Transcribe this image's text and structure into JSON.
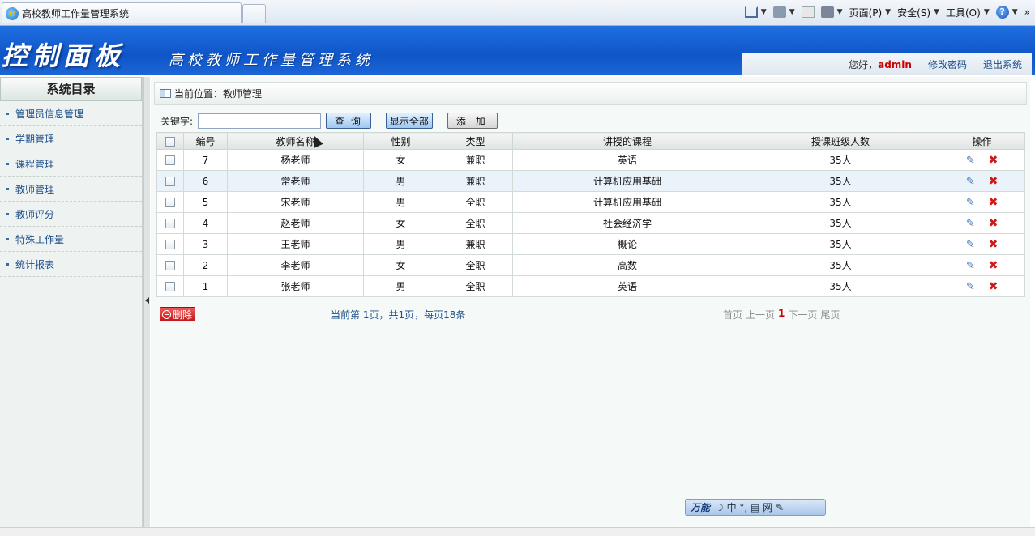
{
  "browser": {
    "tab_title": "高校教师工作量管理系统",
    "menu": {
      "page": "页面(P)",
      "security": "安全(S)",
      "tools": "工具(O)"
    },
    "more": "»"
  },
  "header": {
    "big_title": "控制面板",
    "system_name": "高校教师工作量管理系统",
    "greeting": "您好，",
    "username": "admin",
    "change_password": "修改密码",
    "logout": "退出系统"
  },
  "sidebar": {
    "title": "系统目录",
    "items": [
      {
        "label": "管理员信息管理"
      },
      {
        "label": "学期管理"
      },
      {
        "label": "课程管理"
      },
      {
        "label": "教师管理"
      },
      {
        "label": "教师评分"
      },
      {
        "label": "特殊工作量"
      },
      {
        "label": "统计报表"
      }
    ]
  },
  "main": {
    "breadcrumb": "当前位置：教师管理",
    "search": {
      "label": "关键字:",
      "value": "",
      "query_btn": "查 询",
      "show_all_btn": "显示全部",
      "add_btn": "添 加"
    },
    "table": {
      "columns": [
        "编号",
        "教师名称",
        "性别",
        "类型",
        "讲授的课程",
        "授课班级人数",
        "操作"
      ],
      "rows": [
        {
          "id": "7",
          "name": "杨老师",
          "gender": "女",
          "type": "兼职",
          "course": "英语",
          "class_size": "35人"
        },
        {
          "id": "6",
          "name": "常老师",
          "gender": "男",
          "type": "兼职",
          "course": "计算机应用基础",
          "class_size": "35人"
        },
        {
          "id": "5",
          "name": "宋老师",
          "gender": "男",
          "type": "全职",
          "course": "计算机应用基础",
          "class_size": "35人"
        },
        {
          "id": "4",
          "name": "赵老师",
          "gender": "女",
          "type": "全职",
          "course": "社会经济学",
          "class_size": "35人"
        },
        {
          "id": "3",
          "name": "王老师",
          "gender": "男",
          "type": "兼职",
          "course": "概论",
          "class_size": "35人"
        },
        {
          "id": "2",
          "name": "李老师",
          "gender": "女",
          "type": "全职",
          "course": "高数",
          "class_size": "35人"
        },
        {
          "id": "1",
          "name": "张老师",
          "gender": "男",
          "type": "全职",
          "course": "英语",
          "class_size": "35人"
        }
      ]
    },
    "delete_btn": "删除",
    "page_info": "当前第 1页，共1页，每页18条",
    "pager": {
      "first": "首页",
      "prev": "上一页",
      "current": "1",
      "next": "下一页",
      "last": "尾页"
    }
  },
  "ime": {
    "brand": "万能",
    "glyphs": "☽ 中 °, ▤ 网 ✎"
  }
}
